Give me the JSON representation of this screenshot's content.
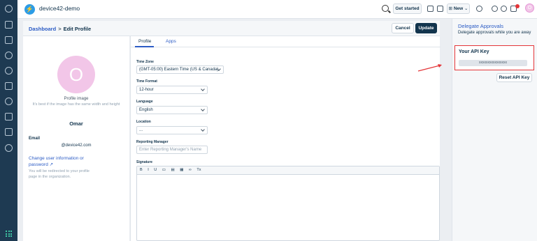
{
  "app": {
    "name": "device42-demo"
  },
  "topbar": {
    "get_started": "Get started",
    "new_label": "New"
  },
  "header": {
    "crumb_dashboard": "Dashboard",
    "separator": ">",
    "crumb_current": "Edit Profile",
    "cancel": "Cancel",
    "update": "Update"
  },
  "profile": {
    "avatar_letter": "O",
    "image_label": "Profile image",
    "image_hint": "It's best if the image has the same width and height",
    "user_name": "Omar",
    "email_label": "Email",
    "email_value": "@device42.com",
    "change_link_1": "Change user information or",
    "change_link_2": "password",
    "redirect_note_1": "You will be redirected to your profile",
    "redirect_note_2": "page in the organization."
  },
  "tabs": {
    "profile": "Profile",
    "apps": "Apps"
  },
  "form": {
    "timezone_label": "Time Zone",
    "timezone_value": "(GMT-05:00) Eastern Time (US & Canada)",
    "timeformat_label": "Time Format",
    "timeformat_value": "12-hour",
    "language_label": "Language",
    "language_value": "English",
    "location_label": "Location",
    "location_value": "...",
    "manager_label": "Reporting Manager",
    "manager_placeholder": "Enter Reporting Manager's Name",
    "signature_label": "Signature"
  },
  "editor_tools": [
    "B",
    "I",
    "U",
    "▭",
    "▤",
    "▦",
    "∞",
    "Tx"
  ],
  "right": {
    "delegate_title": "Delegate Approvals",
    "delegate_sub": "Delegate approvals while you are away",
    "api_title": "Your API Key",
    "api_value": "xxxxxxxxxxxxxxxx",
    "reset": "Reset API Key"
  },
  "colors": {
    "accent": "#2c5cc5",
    "nav": "#1e3a52",
    "highlight": "#e43538"
  }
}
